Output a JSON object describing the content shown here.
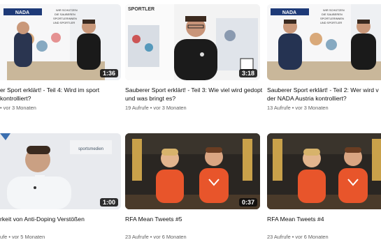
{
  "videos": [
    {
      "title": "er Sport erklärt! - Teil 4: Wird im sport kontrolliert?",
      "meta": "• vor 3 Monaten",
      "duration": "1:36",
      "banner": "NADA",
      "poster_lines": [
        "WIR SCHÜTZEN",
        "DIE SAUBEREN",
        "SPORTLERINNEN",
        "UND SPORTLER"
      ]
    },
    {
      "title": "Sauberer Sport erklärt! - Teil 3: Wie viel wird gedopt und was bringt es?",
      "meta": "19 Aufrufe • vor 3 Monaten",
      "duration": "3:18",
      "poster_lines": [
        "SPORTLER"
      ]
    },
    {
      "title": "Sauberer Sport erklärt! - Teil 2: Wer wird v der NADA Austria kontrolliert?",
      "meta": "13 Aufrufe • vor 3 Monaten",
      "duration": "",
      "banner": "NADA",
      "poster_lines": [
        "WIR SCHÜTZEN",
        "DIE SAUBEREN",
        "SPORTLERINNEN",
        "UND SPORTLER"
      ]
    },
    {
      "title": "rkeit von Anti-Doping Verstößen",
      "meta": "ufe • vor 5 Monaten",
      "duration": "1:00",
      "logo": "sportsmedien"
    },
    {
      "title": "RFA Mean Tweets #5",
      "meta": "23 Aufrufe • vor 6 Monaten",
      "duration": "0:37"
    },
    {
      "title": "RFA Mean Tweets #4",
      "meta": "23 Aufrufe • vor 6 Monaten",
      "duration": ""
    }
  ]
}
